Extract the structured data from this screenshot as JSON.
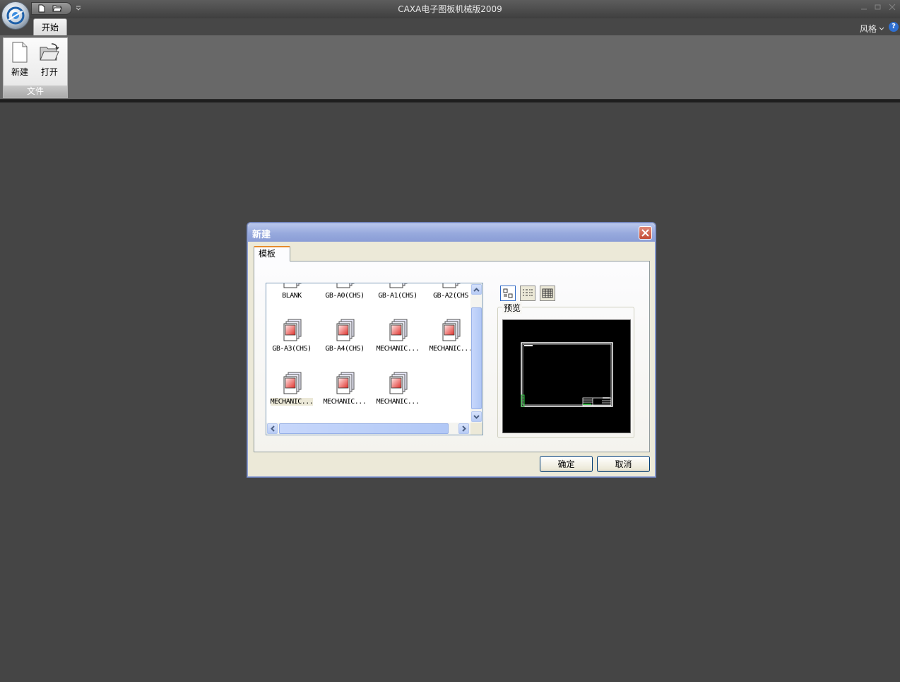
{
  "window": {
    "title": "CAXA电子图板机械版2009"
  },
  "ribbon": {
    "active_tab": "开始",
    "style_menu": "风格",
    "help": "?",
    "group": {
      "label": "文件",
      "buttons": [
        {
          "label": "新建",
          "icon": "new-file-icon"
        },
        {
          "label": "打开",
          "icon": "open-folder-icon"
        }
      ]
    }
  },
  "dialog": {
    "title": "新建",
    "tab": "模板",
    "templates": [
      {
        "name": "BLANK"
      },
      {
        "name": "GB-A0(CHS)"
      },
      {
        "name": "GB-A1(CHS)"
      },
      {
        "name": "GB-A2(CHS"
      },
      {
        "name": "GB-A3(CHS)"
      },
      {
        "name": "GB-A4(CHS)"
      },
      {
        "name": "MECHANIC..."
      },
      {
        "name": "MECHANIC..."
      },
      {
        "name": "MECHANIC..."
      },
      {
        "name": "MECHANIC..."
      },
      {
        "name": "MECHANIC..."
      }
    ],
    "selected_index": 8,
    "view_modes": [
      "large-icons-icon",
      "list-view-icon",
      "details-view-icon"
    ],
    "preview_label": "预览",
    "ok_label": "确定",
    "cancel_label": "取消",
    "colors": {
      "titlebar": "#97a9dd",
      "close": "#c44a35",
      "preview_bg": "#000000"
    }
  }
}
